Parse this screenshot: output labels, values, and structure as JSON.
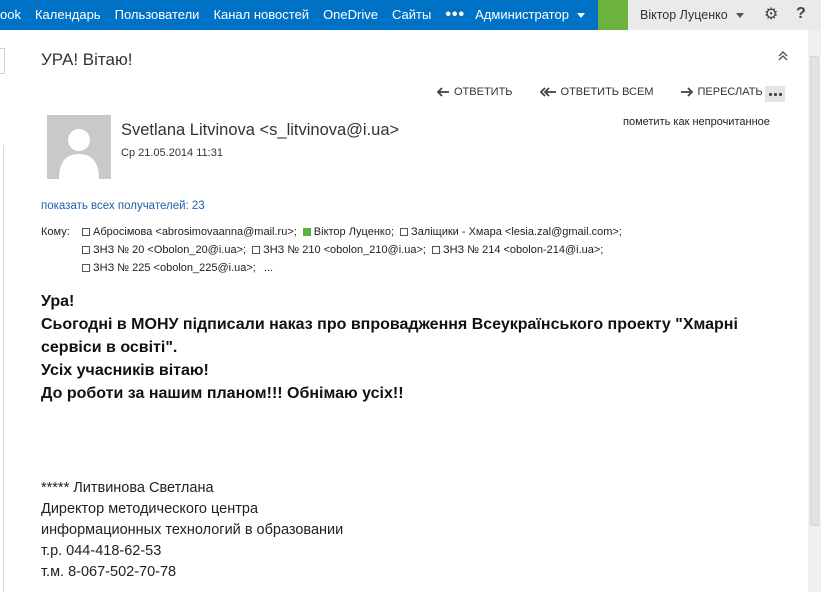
{
  "nav": {
    "items": [
      "ook",
      "Календарь",
      "Пользователи",
      "Канал новостей",
      "OneDrive",
      "Сайты"
    ],
    "more": "•••",
    "admin": "Администратор"
  },
  "user": {
    "name": "Віктор Луценко"
  },
  "colors": {
    "topbar": "#0072c6",
    "green_tile": "#6cb33e",
    "link": "#1f5fa8"
  },
  "icons": {
    "settings": "gear-icon",
    "help": "help-icon",
    "collapse": "chevron-up-double-icon"
  },
  "message": {
    "subject": "УРА! Вітаю!",
    "actions": {
      "reply": "ОТВЕТИТЬ",
      "reply_all": "ОТВЕТИТЬ ВСЕМ",
      "forward": "ПЕРЕСЛАТЬ"
    },
    "mark_unread": "пометить как непрочитанное",
    "sender": "Svetlana Litvinova <s_litvinova@i.ua>",
    "date": "Ср 21.05.2014 11:31",
    "show_recipients": "показать всех получателей: 23",
    "to_label": "Кому:",
    "recipients": [
      "Абросімова <abrosimovaanna@mail.ru>;",
      "Віктор Луценко;",
      "Заліщики - Хмара <lesia.zal@gmail.com>;",
      "ЗНЗ № 20 <Obolon_20@i.ua>;",
      "ЗНЗ № 210 <obolon_210@i.ua>;",
      "ЗНЗ № 214 <obolon-214@i.ua>;",
      "ЗНЗ № 225 <obolon_225@i.ua>;"
    ],
    "recipients_more": "...",
    "body": [
      "Ура!",
      "Сьогодні в МОНУ підписали наказ про впровадження Всеукраїнського проекту \"Хмарні сервіси в освіті\".",
      "Усіх учасників вітаю!",
      "До роботи за нашим планом!!! Обнімаю усіх!!"
    ],
    "signature": [
      "***** Литвинова Светлана",
      "Директор методического центра",
      "информационных технологий в образовании",
      "т.р. 044-418-62-53",
      "т.м. 8-067-502-70-78"
    ]
  }
}
